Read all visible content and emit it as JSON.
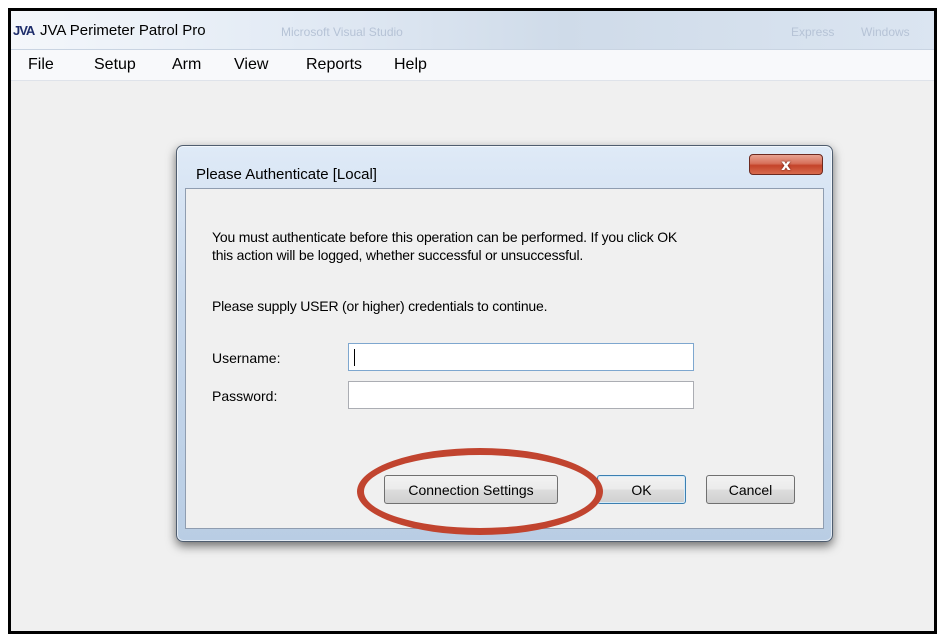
{
  "window": {
    "logo_text": "JVA",
    "title": "JVA Perimeter Patrol Pro",
    "background_ghost_text": [
      "Microsoft Visual Studio",
      "Express",
      "Windows"
    ]
  },
  "menubar": {
    "items": [
      {
        "label": "File"
      },
      {
        "label": "Setup"
      },
      {
        "label": "Arm"
      },
      {
        "label": "View"
      },
      {
        "label": "Reports"
      },
      {
        "label": "Help"
      }
    ]
  },
  "dialog": {
    "title": "Please Authenticate [Local]",
    "close_glyph": "x",
    "message_line1": "You must authenticate before this operation can be performed.  If you click OK",
    "message_line2": "this action will be logged, whether successful or unsuccessful.",
    "credentials_prompt": "Please supply USER (or higher) credentials to continue.",
    "username_label": "Username:",
    "username_value": "",
    "password_label": "Password:",
    "password_value": "",
    "connection_settings_label": "Connection Settings",
    "ok_label": "OK",
    "cancel_label": "Cancel"
  },
  "annotation": {
    "ring_color": "#c1442f",
    "highlighted_target": "Connection Settings"
  },
  "colors": {
    "close_button": "#c4432a",
    "default_button_border": "#3c7fb1"
  }
}
